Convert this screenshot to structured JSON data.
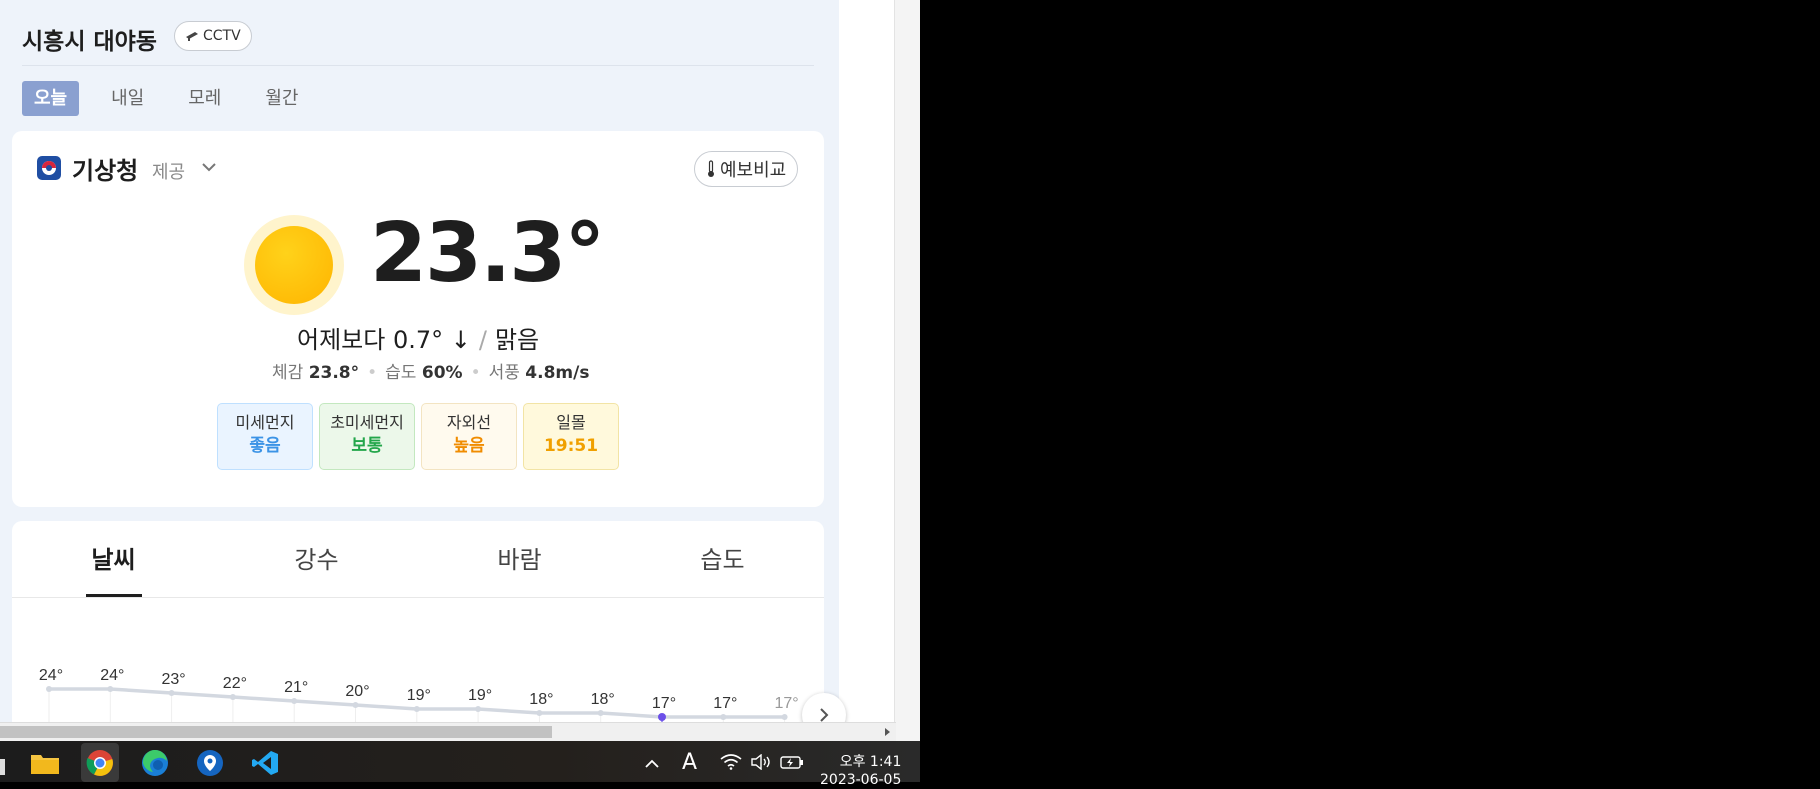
{
  "header": {
    "location": "시흥시 대야동",
    "cctv_label": "CCTV"
  },
  "day_tabs": [
    "오늘",
    "내일",
    "모레",
    "월간"
  ],
  "provider": {
    "name": "기상청",
    "provided": "제공",
    "compare_label": "예보비교"
  },
  "current": {
    "temperature": "23.3°",
    "vs_yesterday": "어제보다 0.7° ↓",
    "sky": "맑음",
    "feels_label": "체감",
    "feels_value": "23.8°",
    "humidity_label": "습도",
    "humidity_value": "60%",
    "wind_label": "서풍",
    "wind_value": "4.8m/s"
  },
  "air": [
    {
      "label": "미세먼지",
      "value": "좋음"
    },
    {
      "label": "초미세먼지",
      "value": "보통"
    },
    {
      "label": "자외선",
      "value": "높음"
    },
    {
      "label": "일몰",
      "value": "19:51"
    }
  ],
  "chart_tabs": [
    "날씨",
    "강수",
    "바람",
    "습도"
  ],
  "chart_data": {
    "type": "line",
    "values": [
      24,
      24,
      23,
      22,
      21,
      20,
      19,
      19,
      18,
      18,
      17,
      17,
      17
    ],
    "labels": [
      "24°",
      "24°",
      "23°",
      "22°",
      "21°",
      "20°",
      "19°",
      "19°",
      "18°",
      "18°",
      "17°",
      "17°",
      "17°"
    ],
    "highlight_index": 10
  },
  "taskbar": {
    "time": "오후 1:41",
    "date": "2023-06-05",
    "ime": "A"
  },
  "colors": {
    "accent": "#8aa0d0",
    "highlight": "#6b4fe8"
  }
}
